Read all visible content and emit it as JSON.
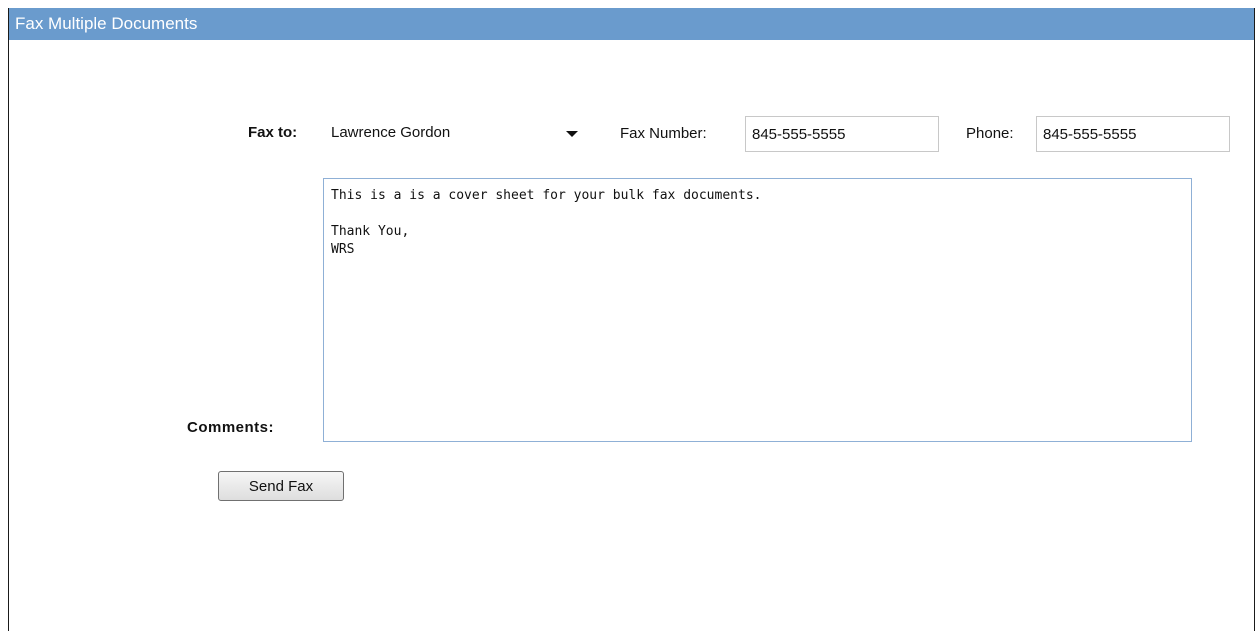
{
  "window": {
    "title": "Fax Multiple Documents"
  },
  "form": {
    "fax_to_label": "Fax to:",
    "fax_to_selected": "Lawrence Gordon",
    "fax_number_label": "Fax Number:",
    "fax_number_value": "845-555-5555",
    "phone_label": "Phone:",
    "phone_value": "845-555-5555",
    "comments_label": "Comments:",
    "comments_value": "This is a is a cover sheet for your bulk fax documents.\n\nThank You,\nWRS",
    "send_button_label": "Send Fax"
  },
  "icons": {
    "dropdown": "caret-down-icon"
  }
}
